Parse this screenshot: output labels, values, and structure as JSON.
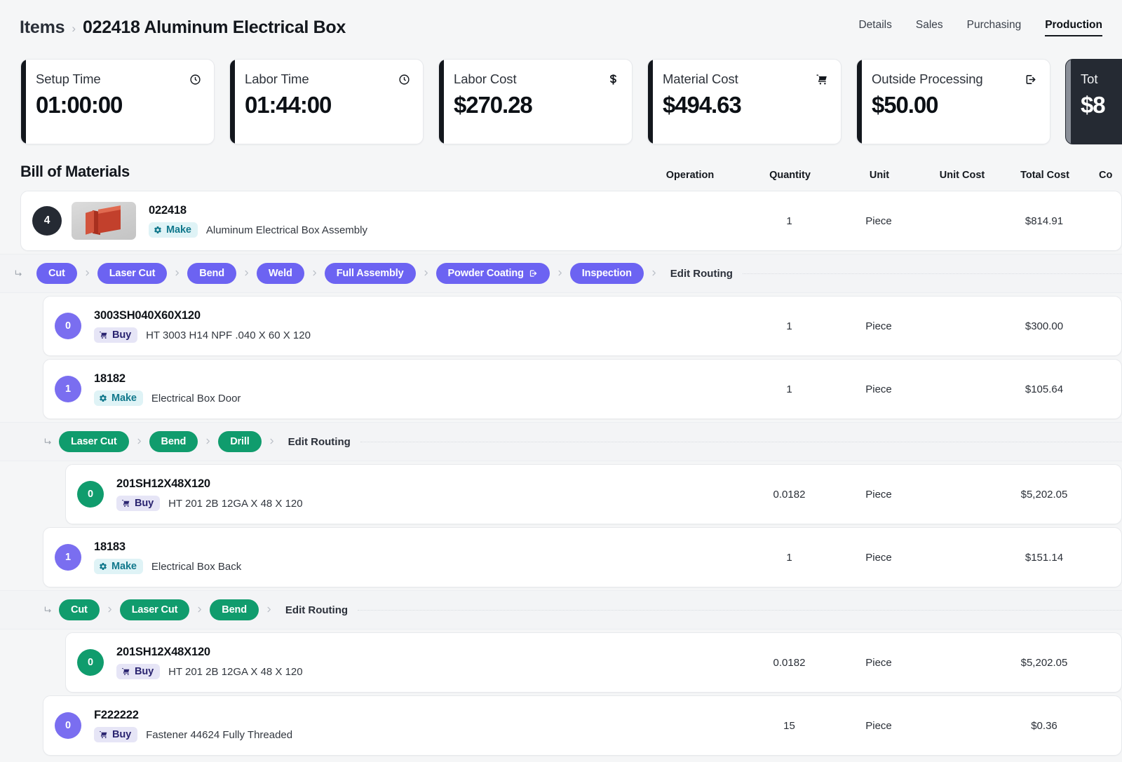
{
  "header": {
    "breadcrumb_root": "Items",
    "breadcrumb_sep": "›",
    "breadcrumb_current": "022418 Aluminum Electrical Box",
    "tabs": [
      {
        "label": "Details",
        "active": false
      },
      {
        "label": "Sales",
        "active": false
      },
      {
        "label": "Purchasing",
        "active": false
      },
      {
        "label": "Production",
        "active": true
      }
    ]
  },
  "metrics": [
    {
      "label": "Setup Time",
      "value": "01:00:00",
      "icon": "clock-icon",
      "dark": false
    },
    {
      "label": "Labor Time",
      "value": "01:44:00",
      "icon": "clock-icon",
      "dark": false
    },
    {
      "label": "Labor Cost",
      "value": "$270.28",
      "icon": "dollar-icon",
      "dark": false
    },
    {
      "label": "Material Cost",
      "value": "$494.63",
      "icon": "cart-icon",
      "dark": false
    },
    {
      "label": "Outside Processing",
      "value": "$50.00",
      "icon": "external-link-icon",
      "dark": false
    },
    {
      "label": "Tot",
      "value": "$8",
      "icon": "",
      "dark": true
    }
  ],
  "bom": {
    "title": "Bill of Materials",
    "columns": [
      "Operation",
      "Quantity",
      "Unit",
      "Unit Cost",
      "Total Cost"
    ],
    "column_clipped": "Co",
    "edit_routing_label": "Edit Routing",
    "rows": [
      {
        "kind": "item",
        "level": 0,
        "badge": "4",
        "badge_color": "dark",
        "thumbnail": true,
        "code": "022418",
        "tag": "Make",
        "tag_type": "make",
        "description": "Aluminum Electrical Box Assembly",
        "operation": "",
        "quantity": "1",
        "unit": "Piece",
        "unit_cost": "",
        "total_cost": "$814.91"
      },
      {
        "kind": "routing",
        "indent": 0,
        "pill_color": "purple",
        "operations": [
          {
            "label": "Cut",
            "external": false
          },
          {
            "label": "Laser Cut",
            "external": false
          },
          {
            "label": "Bend",
            "external": false
          },
          {
            "label": "Weld",
            "external": false
          },
          {
            "label": "Full Assembly",
            "external": false
          },
          {
            "label": "Powder Coating",
            "external": true
          },
          {
            "label": "Inspection",
            "external": false
          }
        ]
      },
      {
        "kind": "item",
        "level": 1,
        "badge": "0",
        "badge_color": "purple",
        "thumbnail": false,
        "code": "3003SH040X60X120",
        "tag": "Buy",
        "tag_type": "buy",
        "description": "HT 3003 H14 NPF .040 X 60 X 120",
        "operation": "",
        "quantity": "1",
        "unit": "Piece",
        "unit_cost": "",
        "total_cost": "$300.00"
      },
      {
        "kind": "item",
        "level": 1,
        "badge": "1",
        "badge_color": "purple",
        "thumbnail": false,
        "code": "18182",
        "tag": "Make",
        "tag_type": "make",
        "description": "Electrical Box Door",
        "operation": "",
        "quantity": "1",
        "unit": "Piece",
        "unit_cost": "",
        "total_cost": "$105.64"
      },
      {
        "kind": "routing",
        "indent": 1,
        "pill_color": "green",
        "operations": [
          {
            "label": "Laser Cut",
            "external": false
          },
          {
            "label": "Bend",
            "external": false
          },
          {
            "label": "Drill",
            "external": false
          }
        ]
      },
      {
        "kind": "item",
        "level": 2,
        "badge": "0",
        "badge_color": "green",
        "thumbnail": false,
        "code": "201SH12X48X120",
        "tag": "Buy",
        "tag_type": "buy",
        "description": "HT 201 2B 12GA X 48 X 120",
        "operation": "",
        "quantity": "0.0182",
        "unit": "Piece",
        "unit_cost": "",
        "total_cost": "$5,202.05"
      },
      {
        "kind": "item",
        "level": 1,
        "badge": "1",
        "badge_color": "purple",
        "thumbnail": false,
        "code": "18183",
        "tag": "Make",
        "tag_type": "make",
        "description": "Electrical Box Back",
        "operation": "",
        "quantity": "1",
        "unit": "Piece",
        "unit_cost": "",
        "total_cost": "$151.14"
      },
      {
        "kind": "routing",
        "indent": 1,
        "pill_color": "green",
        "operations": [
          {
            "label": "Cut",
            "external": false
          },
          {
            "label": "Laser Cut",
            "external": false
          },
          {
            "label": "Bend",
            "external": false
          }
        ]
      },
      {
        "kind": "item",
        "level": 2,
        "badge": "0",
        "badge_color": "green",
        "thumbnail": false,
        "code": "201SH12X48X120",
        "tag": "Buy",
        "tag_type": "buy",
        "description": "HT 201 2B 12GA X 48 X 120",
        "operation": "",
        "quantity": "0.0182",
        "unit": "Piece",
        "unit_cost": "",
        "total_cost": "$5,202.05"
      },
      {
        "kind": "item",
        "level": 1,
        "badge": "0",
        "badge_color": "purple",
        "thumbnail": false,
        "code": "F222222",
        "tag": "Buy",
        "tag_type": "buy",
        "description": "Fastener 44624 Fully Threaded",
        "operation": "",
        "quantity": "15",
        "unit": "Piece",
        "unit_cost": "",
        "total_cost": "$0.36"
      }
    ]
  },
  "colors": {
    "purple": "#6c63f2",
    "green": "#109c6d",
    "dark": "#252a33",
    "make_tag_bg": "#dff3f6",
    "make_tag_fg": "#11788c",
    "buy_tag_bg": "#e6e5f6",
    "buy_tag_fg": "#2a2470",
    "page_bg": "#f5f6f7"
  }
}
